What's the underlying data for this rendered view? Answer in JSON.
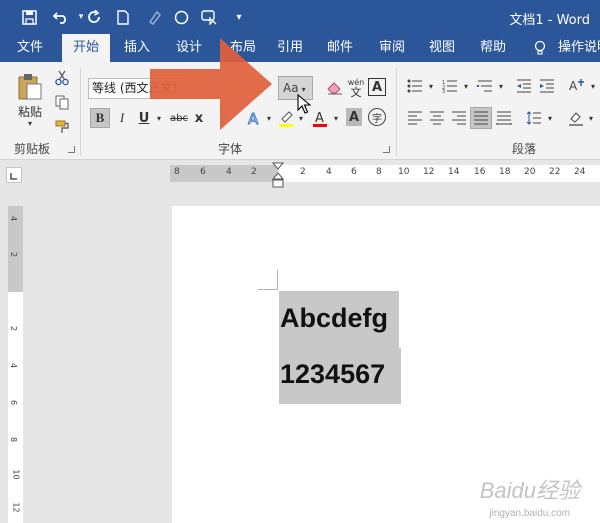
{
  "app": {
    "title": "文档1  -  Word",
    "quick_access": [
      "save-icon",
      "undo-icon",
      "redo-icon",
      "new-doc-icon",
      "format-painter-icon",
      "circle-icon",
      "touch-mode-icon",
      "customize-icon"
    ]
  },
  "tabs": [
    {
      "label": "文件",
      "active": false
    },
    {
      "label": "开始",
      "active": true
    },
    {
      "label": "插入",
      "active": false
    },
    {
      "label": "设计",
      "active": false
    },
    {
      "label": "布局",
      "active": false
    },
    {
      "label": "引用",
      "active": false
    },
    {
      "label": "邮件",
      "active": false
    },
    {
      "label": "审阅",
      "active": false
    },
    {
      "label": "视图",
      "active": false
    },
    {
      "label": "帮助",
      "active": false
    }
  ],
  "tell_me": "操作说明",
  "ribbon": {
    "clipboard": {
      "paste_label": "粘贴",
      "group_label": "剪贴板"
    },
    "font": {
      "font_name": "等线 (西文正文)",
      "change_case_label": "Aa",
      "bold": "B",
      "italic": "I",
      "underline": "U",
      "strike": "abc",
      "subscript": "x",
      "pinyin_top": "wén",
      "pinyin_bottom": "文",
      "char_border": "A",
      "char_shade": "A",
      "enclose": "字",
      "group_label": "字体"
    },
    "paragraph": {
      "group_label": "段落"
    }
  },
  "ruler": {
    "h_ticks": [
      "8",
      "6",
      "4",
      "2",
      "2",
      "4",
      "6",
      "8",
      "10",
      "12",
      "14",
      "16",
      "18",
      "20",
      "22",
      "24"
    ],
    "v_ticks": [
      "4",
      "2",
      "2",
      "4",
      "6",
      "8",
      "10",
      "12"
    ]
  },
  "document": {
    "lines": [
      "Abcdefg",
      "1234567"
    ]
  },
  "colors": {
    "brand": "#2b579a",
    "arrow": "#e0603c",
    "highlight": "#ffff00",
    "font_color": "#ff0000",
    "selection": "#c8c8c8"
  },
  "watermark": {
    "main": "Baidu经验",
    "sub": "jingyan.baidu.com"
  }
}
